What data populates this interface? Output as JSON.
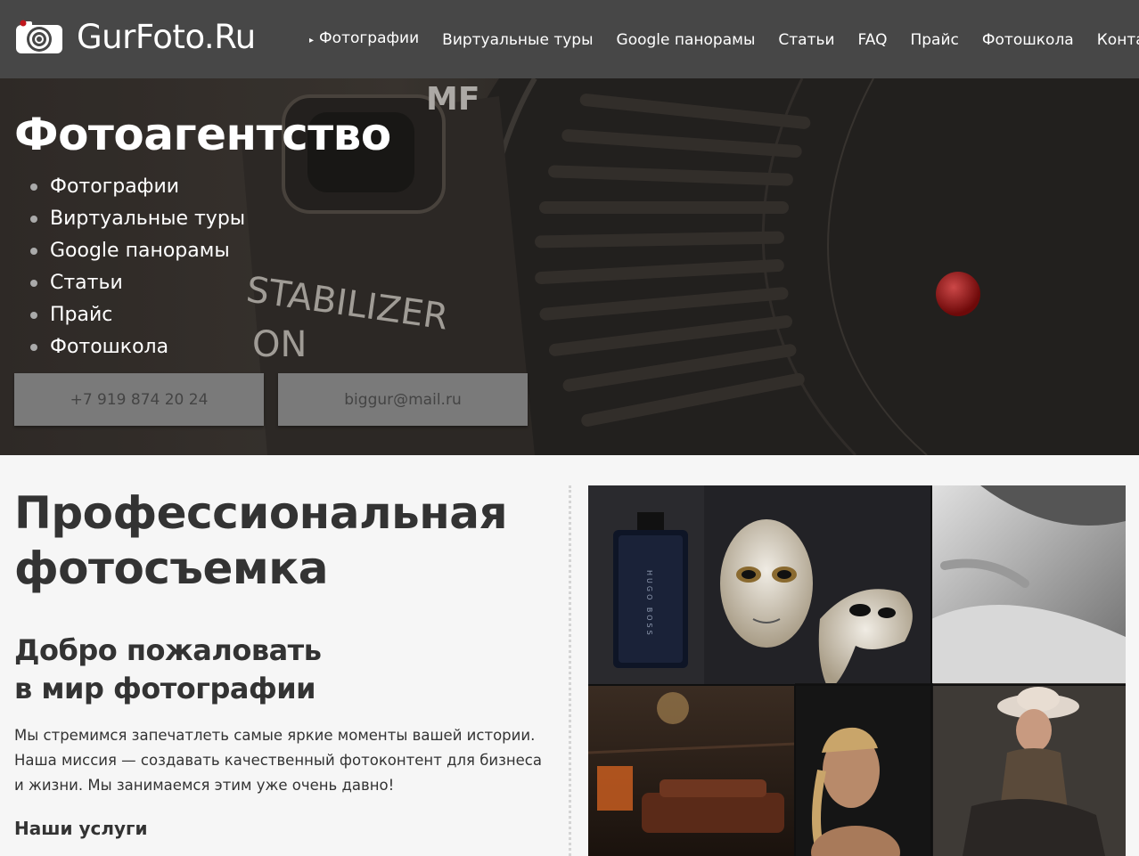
{
  "site": {
    "logo_text": "GurFoto.Ru",
    "logo_icon": "camera-icon"
  },
  "nav": {
    "items": [
      {
        "label": "Фотографии",
        "has_submenu": true
      },
      {
        "label": "Виртуальные туры"
      },
      {
        "label": "Google панорамы"
      },
      {
        "label": "Статьи"
      },
      {
        "label": "FAQ"
      },
      {
        "label": "Прайс"
      },
      {
        "label": "Фотошкола"
      },
      {
        "label": "Контакты"
      }
    ],
    "submenu_arrow": "▸"
  },
  "hero": {
    "title": "Фотоагентство",
    "links": [
      "Фотографии",
      "Виртуальные туры",
      "Google панорамы",
      "Статьи",
      "Прайс",
      "Фотошкола"
    ],
    "phone_button": "+7 919 874 20 24",
    "email_button": "biggur@mail.ru",
    "bg_text_mf": "MF",
    "bg_text_stabilizer": "STABILIZER",
    "bg_text_on": "ON"
  },
  "main": {
    "title_line1": "Профессиональная",
    "title_line2": "фотосъемка",
    "subtitle_line1": "Добро пожаловать",
    "subtitle_line2": "в мир фотографии",
    "intro": "Мы стремимся запечатлеть самые яркие моменты вашей истории. Наша миссия — создавать качественный фотоконтент для бизнеса и жизни. Мы занимаемся этим уже очень давно!",
    "services_title": "Наши услуги"
  },
  "collage": {
    "bottle_text": "HUGO BOSS"
  },
  "colors": {
    "header_bg": "#474747",
    "button_bg": "#7a7a7a",
    "page_bg": "#f6f6f6",
    "text": "#333333",
    "accent_red": "#c0161c"
  }
}
